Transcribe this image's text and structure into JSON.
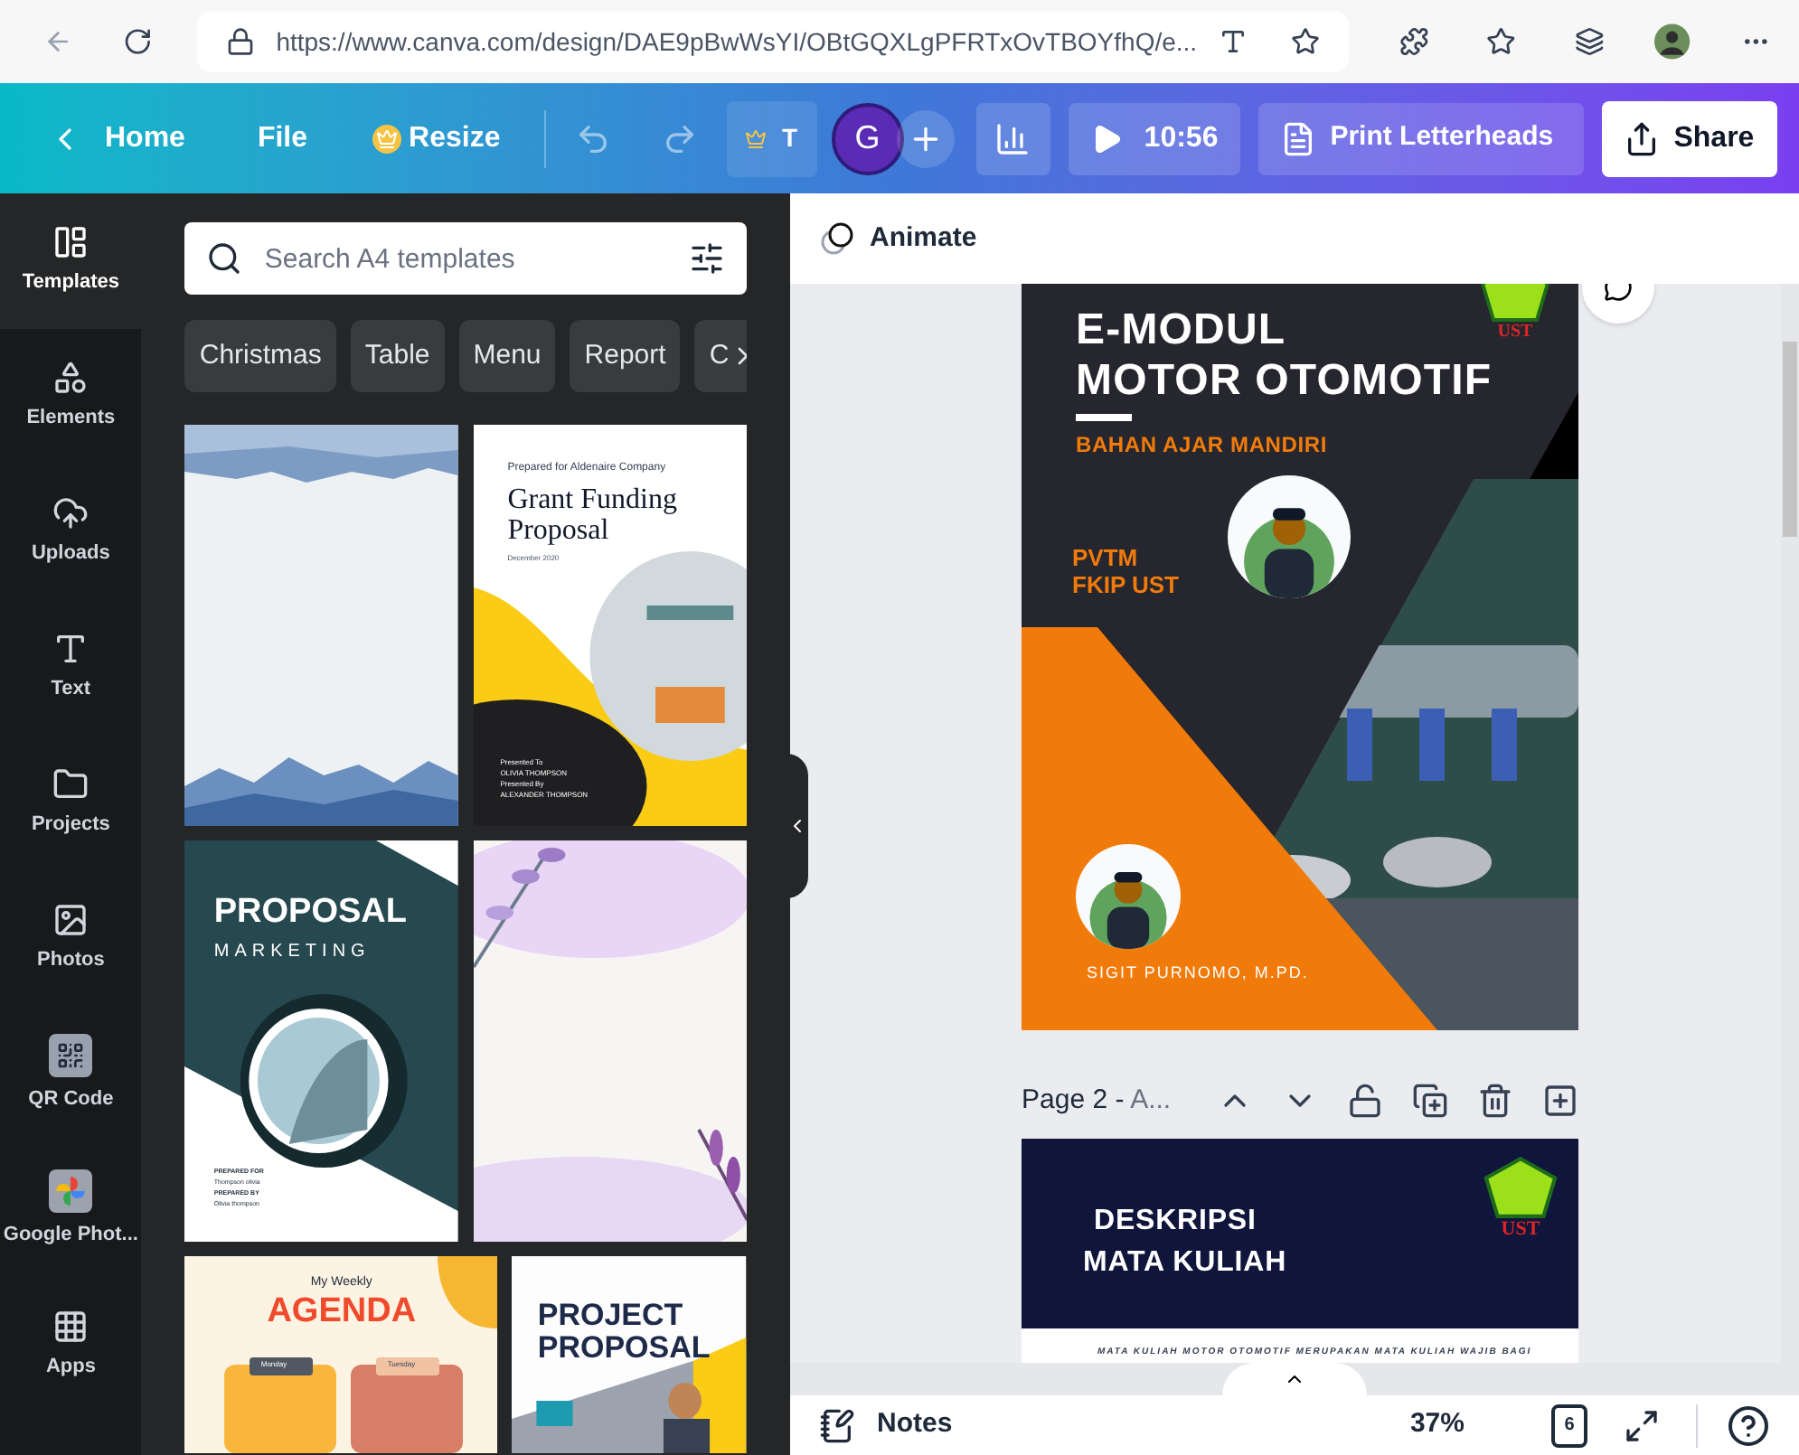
{
  "browser": {
    "url": "https://www.canva.com/design/DAE9pBwWsYI/OBtGQXLgPFRTxOvTBOYfhQ/e..."
  },
  "toolbar": {
    "home": "Home",
    "file": "File",
    "resize": "Resize",
    "crown_label": "T",
    "avatar": "G",
    "timer": "10:56",
    "print": "Print Letterheads",
    "share": "Share"
  },
  "sidebar": {
    "items": [
      {
        "kind": "templates",
        "label": "Templates",
        "selected": true
      },
      {
        "kind": "elements",
        "label": "Elements",
        "selected": false
      },
      {
        "kind": "uploads",
        "label": "Uploads",
        "selected": false
      },
      {
        "kind": "text",
        "label": "Text",
        "selected": false
      },
      {
        "kind": "projects",
        "label": "Projects",
        "selected": false
      },
      {
        "kind": "photos",
        "label": "Photos",
        "selected": false
      },
      {
        "kind": "qr",
        "label": "QR Code",
        "selected": false
      },
      {
        "kind": "gphotos",
        "label": "Google Phot...",
        "selected": false
      },
      {
        "kind": "apps",
        "label": "Apps",
        "selected": false
      }
    ]
  },
  "panel": {
    "search": {
      "placeholder": "Search A4 templates"
    },
    "chips": [
      "Christmas",
      "Table",
      "Menu",
      "Report",
      "C"
    ],
    "templates": [
      {
        "kind": "watercolor"
      },
      {
        "kind": "grant",
        "texts": [
          "Prepared for Aldenaire Company",
          "Grant Funding Proposal",
          "December 2020",
          "Presented To",
          "OLIVIA THOMPSON",
          "Presented By",
          "ALEXANDER THOMPSON"
        ]
      },
      {
        "kind": "marketing",
        "texts": [
          "PROPOSAL",
          "MARKETING",
          "PREPARED FOR",
          "Thompson olivia",
          "PREPARED BY",
          "Olivia thompson"
        ]
      },
      {
        "kind": "floral"
      },
      {
        "kind": "agenda",
        "texts": [
          "My Weekly",
          "AGENDA",
          "Monday",
          "Tuesday"
        ]
      },
      {
        "kind": "project",
        "texts": [
          "PROJECT",
          "PROPOSAL"
        ]
      }
    ]
  },
  "canvas": {
    "animate": "Animate",
    "page1": {
      "title_1": "E-MODUL",
      "title_2": "MOTOR OTOMOTIF",
      "subtitle": "BAHAN AJAR MANDIRI",
      "org_1": "PVTM",
      "org_2": "FKIP UST",
      "logo": "UST",
      "author": "SIGIT PURNOMO, M.PD."
    },
    "page2": {
      "label": "Page 2 -",
      "title": "A...",
      "heading_1": "DESKRIPSI",
      "heading_2": "MATA KULIAH",
      "logo": "UST",
      "body": "MATA KULIAH MOTOR OTOMOTIF MERUPAKAN MATA KULIAH WAJIB BAGI"
    }
  },
  "footer": {
    "notes": "Notes",
    "zoom": "37%",
    "pages": "6"
  }
}
